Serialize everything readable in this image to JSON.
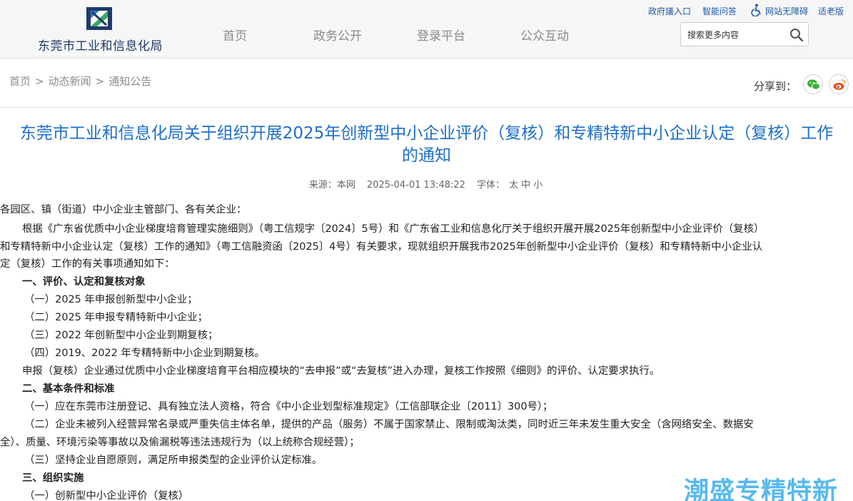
{
  "site": {
    "name": "东莞市工业和信息化局"
  },
  "nav": [
    "首页",
    "政务公开",
    "登录平台",
    "公众互动"
  ],
  "toplinks": {
    "mailbox": "政府議入口",
    "qa": "智能问答",
    "accessible": "网站无障碍",
    "elderly": "适老版"
  },
  "search": {
    "placeholder": "搜索更多内容"
  },
  "breadcrumb": {
    "home": "首页",
    "sep1": ">",
    "news": "动态新闻",
    "sep2": ">",
    "notice": "通知公告"
  },
  "share": {
    "label": "分享到："
  },
  "article": {
    "title_line1": "东莞市工业和信息化局关于组织开展2025年创新型中小企业评价（复核）和专精特新中小企业认定（复核）工作",
    "title_line2": "的通知",
    "source_label": "来源：",
    "source": "本网",
    "datetime": "2025-04-01 13:48:22",
    "font_label": "字体：",
    "font_large": "太",
    "font_medium": "中",
    "font_small": "小",
    "lines": [
      "各园区、镇（街道）中小企业主管部门、各有关企业：",
      "根据《广东省优质中小企业梯度培育管理实施细则》（粤工信规字〔2024〕5号）和《广东省工业和信息化厅关于组织开展开展2025年创新型中小企业评价（复核）",
      "和专精特新中小企业认定（复核）工作的通知》（粤工信融资函〔2025〕4号）有关要求，现就组织开展我市2025年创新型中小企业评价（复核）和专精特新中小企业认",
      "定（复核）工作的有关事项通知如下：",
      "一、评价、认定和复核对象",
      "（一）2025 年申报创新型中小企业；",
      "（二）2025 年申报专精特新中小企业；",
      "（三）2022 年创新型中小企业到期复核；",
      "（四）2019、2022 年专精特新中小企业到期复核。",
      "申报（复核）企业通过优质中小企业梯度培育平台相应模块的“去申报”或“去复核”进入办理，复核工作按照《细则》的评价、认定要求执行。",
      "二、基本条件和标准",
      "（一）应在东莞市注册登记、具有独立法人资格，符合《中小企业划型标准规定》（工信部联企业〔2011〕300号）；",
      "（二）企业未被列入经营异常名录或严重失信主体名单，提供的产品（服务）不属于国家禁止、限制或淘汰类，同时近三年未发生重大安全（含网络安全、数据安",
      "全）、质量、环境污染等事故以及偷漏税等违法违规行为（以上统称合规经营）；",
      "（三）坚持企业自愿原则，满足所申报类型的企业评价认定标准。",
      "三、组织实施",
      "（一）创新型中小企业评价（复核）"
    ]
  },
  "watermark": "潮盛专精特新",
  "colors": {
    "title": "#1e6fc8",
    "link": "#1f5aa6",
    "watermark": "#4fb6ef",
    "wechat": "#3cb034",
    "weibo": "#e6541e"
  }
}
